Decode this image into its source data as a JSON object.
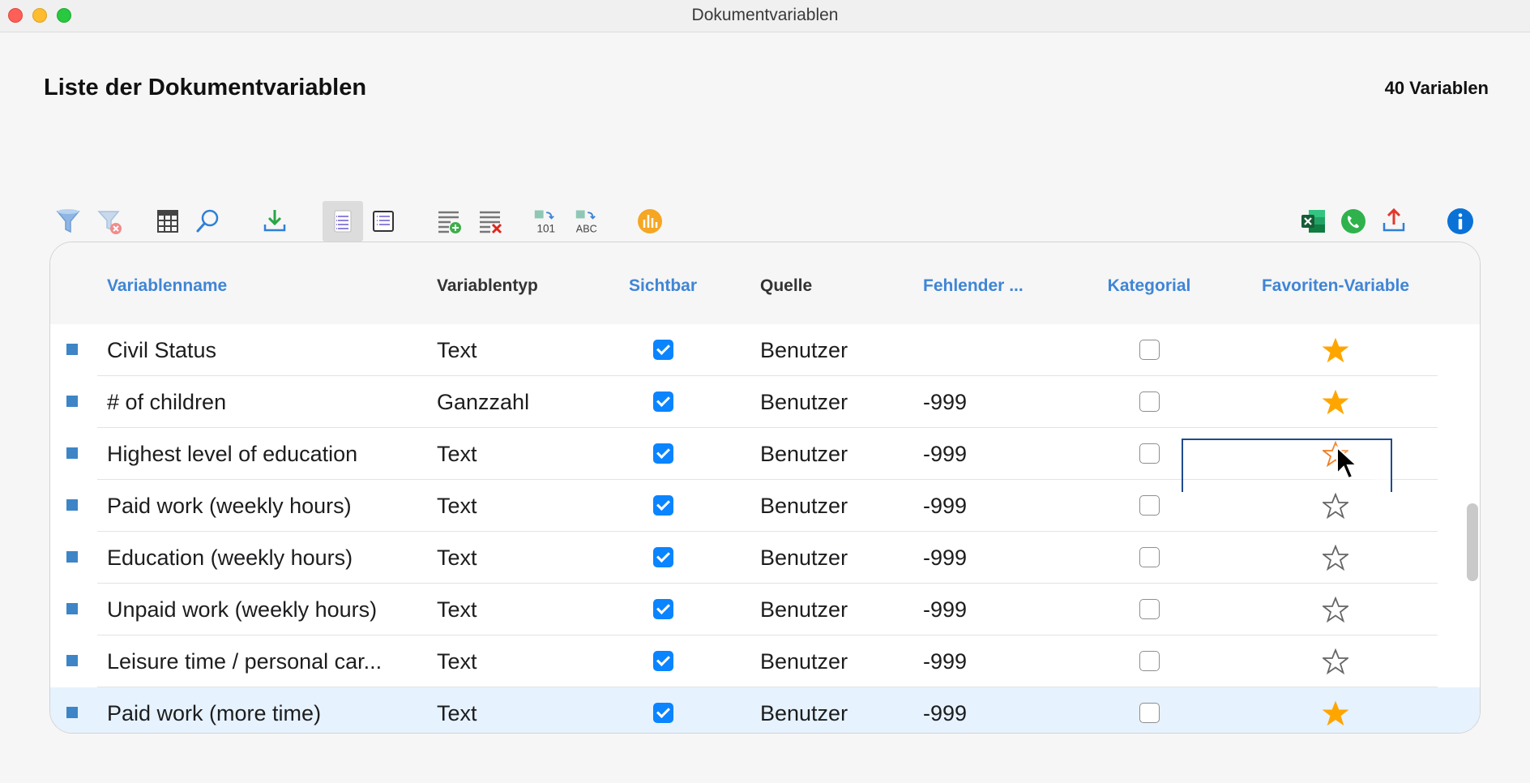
{
  "window": {
    "title": "Dokumentvariablen"
  },
  "header": {
    "title": "Liste der Dokumentvariablen",
    "count": "40 Variablen"
  },
  "toolbar": {
    "left_icons": [
      "filter-icon",
      "clear-filter-icon",
      "table-icon",
      "search-icon",
      "import-icon",
      "list-view-icon",
      "detail-view-icon",
      "add-variable-icon",
      "delete-variable-icon",
      "convert-number-icon",
      "convert-text-icon",
      "chart-icon"
    ],
    "right_icons": [
      "excel-icon",
      "phone-icon",
      "export-icon",
      "info-icon"
    ],
    "convert_number_label": "101",
    "convert_text_label": "ABC"
  },
  "table": {
    "columns": {
      "name": "Variablenname",
      "type": "Variablentyp",
      "visible": "Sichtbar",
      "source": "Quelle",
      "missing": "Fehlender ...",
      "categorical": "Kategorial",
      "favorite": "Favoriten-Variable"
    },
    "rows": [
      {
        "name": "Civil Status",
        "type": "Text",
        "visible": true,
        "source": "Benutzer",
        "missing": "",
        "categorical": false,
        "favorite": "filled"
      },
      {
        "name": "# of children",
        "type": "Ganzzahl",
        "visible": true,
        "source": "Benutzer",
        "missing": "-999",
        "categorical": false,
        "favorite": "filled"
      },
      {
        "name": "Highest level of education",
        "type": "Text",
        "visible": true,
        "source": "Benutzer",
        "missing": "-999",
        "categorical": false,
        "favorite": "hover"
      },
      {
        "name": "Paid work (weekly hours)",
        "type": "Text",
        "visible": true,
        "source": "Benutzer",
        "missing": "-999",
        "categorical": false,
        "favorite": "empty"
      },
      {
        "name": "Education (weekly hours)",
        "type": "Text",
        "visible": true,
        "source": "Benutzer",
        "missing": "-999",
        "categorical": false,
        "favorite": "empty"
      },
      {
        "name": "Unpaid work (weekly hours)",
        "type": "Text",
        "visible": true,
        "source": "Benutzer",
        "missing": "-999",
        "categorical": false,
        "favorite": "empty"
      },
      {
        "name": "Leisure time / personal car...",
        "type": "Text",
        "visible": true,
        "source": "Benutzer",
        "missing": "-999",
        "categorical": false,
        "favorite": "empty"
      },
      {
        "name": "Paid work (more time)",
        "type": "Text",
        "visible": true,
        "source": "Benutzer",
        "missing": "-999",
        "categorical": false,
        "favorite": "filled"
      }
    ]
  },
  "colors": {
    "accent": "#3f85d6",
    "star": "#ffa500",
    "row_marker": "#3d85c6",
    "checkbox": "#0a84ff"
  }
}
